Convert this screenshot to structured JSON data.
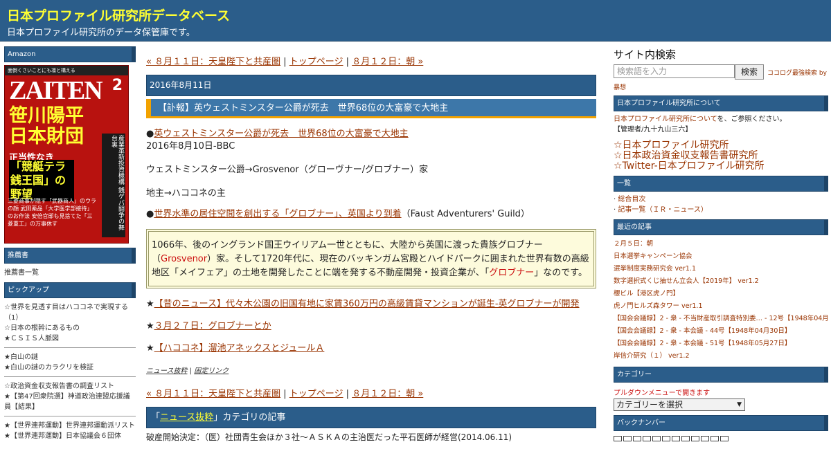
{
  "header": {
    "title": "日本プロファイル研究所データベース",
    "description": "日本プロファイル研究所のデータ保管庫です。"
  },
  "left": {
    "amazon_heading": "Amazon",
    "book": {
      "topline": "面倒くさいことにも凛と構える",
      "logo": "ZAITEN",
      "issue": "2",
      "title1": "笹川陽平",
      "title2": "日本財団",
      "subtitle": "正当性なき",
      "subtitle2": "「競艇テラ銭王国」の野望",
      "side_text": "産業革新投資機構 銭ゲバ闘争の舞台裏",
      "bottom_text": "三菱商事が隠す「武器商人」のウラの顔 武田薬品「大学医学部接待」のお作法 安倍官邸も見捨てた「三菱重工」の万事休す"
    },
    "recommend_heading": "推薦書",
    "recommend_link": "推薦書一覧",
    "pickup_heading": "ピックアップ",
    "pickup_groups": [
      [
        "☆世界を見透す目はハココネで実現する（1）",
        "☆日本の根幹にあるもの",
        "★ＣＳＩＳ人脈図"
      ],
      [
        "★白山の謎",
        "★白山の謎のカラクリを検証"
      ],
      [
        "☆政治資金収支報告書の調査リスト",
        "★【第47回衆院選】神道政治連盟応援議員【結果】"
      ],
      [
        "★【世界連邦運動】世界連邦運動派リスト",
        "★【世界連邦運動】日本協議会６団体"
      ]
    ]
  },
  "main": {
    "nav": {
      "prev": "« ８月１１日：天皇陛下と共産圏",
      "top": "トップページ",
      "next": "８月１２日：朝 »",
      "sep": "|"
    },
    "date": "2016年8月11日",
    "post_title": "【訃報】英ウェストミンスター公爵が死去　世界68位の大富豪で大地主",
    "body": {
      "bullet1": "●",
      "link1": "英ウェストミンスター公爵が死去　世界68位の大富豪で大地主",
      "line1b": "2016年8月10日-BBC",
      "line2": "ウェストミンスター公爵→Grosvenor（グローヴナー/グロブナー）家",
      "line3": "地主→ハココネの主",
      "bullet4": "●",
      "link4": "世界水準の居住空間を創出する「グロブナー」、英国より到着",
      "line4b": "（Faust Adventurers' Guild）",
      "quote_a": "1066年、後のイングランド国王ウイリアム一世とともに、大陸から英国に渡った貴族グロブナー（",
      "quote_red1": "Grosvenor",
      "quote_b": "）家。そして1720年代に、現在のバッキンガム宮殿とハイドパークに囲まれた世界有数の高級地区「メイフェア」の土地を開発したことに端を発する不動産開発・投資企業が、「",
      "quote_red2": "グロブナー",
      "quote_c": "」なのです。",
      "star": "★",
      "star_links": [
        "【昔のニュース】代々木公園の旧国有地に家賃360万円の高級賃貸マンションが誕生-英グロブナーが開発",
        "３月２７日：グロブナーとか",
        "【ハココネ】溜池アネックスとジュールＡ"
      ]
    },
    "foot": {
      "category": "ニュース抜粋",
      "sep": " | ",
      "permalink": "固定リンク"
    },
    "category_bar": {
      "open": "「",
      "link": "ニュース抜粋",
      "close": "」カテゴリの記事"
    },
    "category_first": "破産開始決定：（医）社団青生会ほか３社～ＡＳＫＡの主治医だった平石医師が経営(2014.06.11)"
  },
  "right": {
    "search_title": "サイト内検索",
    "search_placeholder": "検索語を入力",
    "search_button": "検索",
    "search_credit": "ココログ最強検索 by",
    "search_credit2": "暴想",
    "about_heading": "日本プロファイル研究所について",
    "about_link": "日本プロファイル研究所について",
    "about_suffix": "を、ご参照ください。",
    "admin": "【管理者/九十九山三六】",
    "big_links": [
      "☆日本プロファイル研究所",
      "☆日本政治資金収支報告書研究所",
      "☆Twitter-日本プロファイル研究所"
    ],
    "list_heading": "一覧",
    "list_items": [
      "総合目次",
      "記事一覧（ＩＲ・ニュース）"
    ],
    "recent_heading": "最近の記事",
    "recent_items": [
      "２月５日：朝",
      "日本選挙キャンペーン協会",
      "選挙制度実務研究会 ver1.1",
      "数字選択式くじ抽せん立会人【2019年】 ver1.2",
      "櫻ビル【港区虎ノ門】",
      "虎ノ門ヒルズ森タワー ver1.1",
      "【国会会議録】2 - 衆 - 不当財産取引調査特別委… - 12号【1948年04月06日】",
      "【国会会議録】2 - 衆 - 本会議 - 44号【1948年04月30日】",
      "【国会会議録】2 - 衆 - 本会議 - 51号【1948年05月27日】",
      "岸信介研究（１） ver1.2"
    ],
    "category_heading": "カテゴリー",
    "pulldown_note": "プルダウンメニューで開きます",
    "category_select": "カテゴリーを選択",
    "backnumber_heading": "バックナンバー"
  },
  "colors": {
    "header_bg": "#2b5d8a",
    "title_yellow": "#ffff33",
    "link": "#993300",
    "accent_orange": "#f2a200",
    "quote_bg": "#fdfbdc"
  }
}
